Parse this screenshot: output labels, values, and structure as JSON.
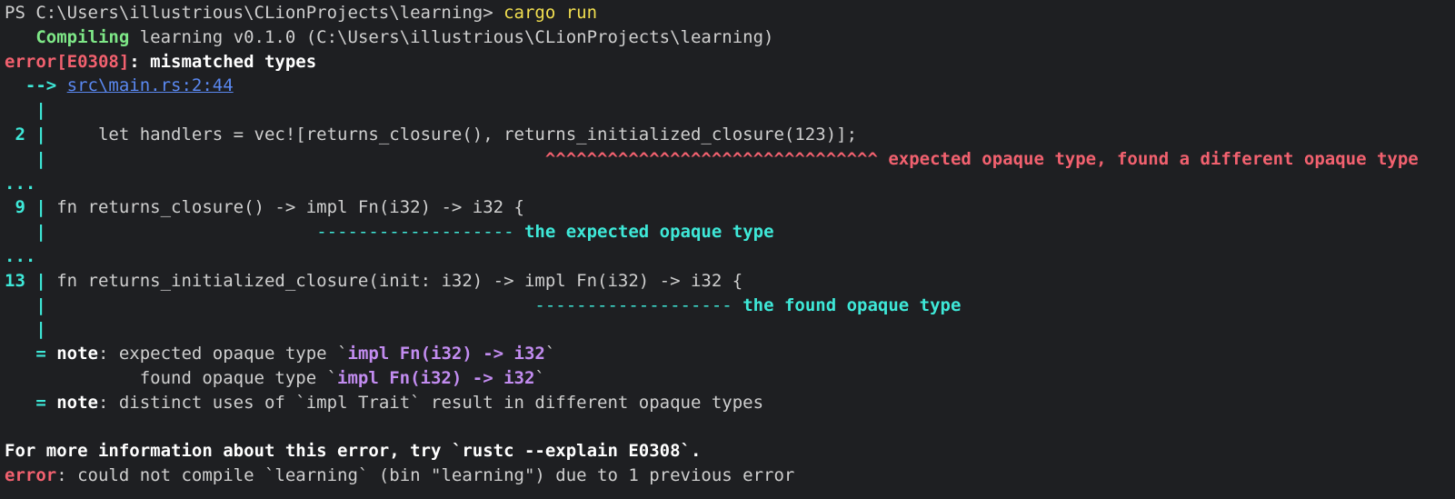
{
  "prompt": {
    "prefix": "PS C:\\Users\\illustrious\\CLionProjects\\learning> ",
    "command": "cargo run"
  },
  "compiling": {
    "label": "Compiling",
    "text": " learning v0.1.0 (C:\\Users\\illustrious\\CLionProjects\\learning)"
  },
  "error_header": {
    "code": "error[E0308]",
    "message": ": mismatched types"
  },
  "location": {
    "arrow": "  --> ",
    "path": "src\\main.rs:2:44"
  },
  "snippet": {
    "gutter_blank": "   |",
    "line2_num": " 2 |",
    "line2_code": "     let handlers = vec![returns_closure(), returns_initialized_closure(123)];",
    "line2_marker_pad": "                                                ",
    "line2_carets": "^^^^^^^^^^^^^^^^^^^^^^^^^^^^^^^^",
    "line2_message": " expected opaque type, found a different opaque type",
    "ellipsis": "...",
    "line9_num": " 9 |",
    "line9_code": " fn returns_closure() -> impl Fn(i32) -> i32 {",
    "line9_pad": "                          ",
    "line9_dashes": "-------------------",
    "line9_message": " the expected opaque type",
    "line13_num": "13 |",
    "line13_code": " fn returns_initialized_closure(init: i32) -> impl Fn(i32) -> i32 {",
    "line13_pad": "                                               ",
    "line13_dashes": "-------------------",
    "line13_message": " the found opaque type"
  },
  "notes": {
    "eq": "   = ",
    "note_label": "note",
    "note1_prefix": ": expected opaque type `",
    "note1_type": "impl Fn(i32) -> i32",
    "tick": "`",
    "note1b_prefix": "             found opaque type `",
    "note1b_type": "impl Fn(i32) -> i32",
    "note2_text": ": distinct uses of `impl Trait` result in different opaque types"
  },
  "footer": {
    "info": "For more information about this error, try `rustc --explain E0308`.",
    "error_label": "error",
    "error_text": ": could not compile `learning` (bin \"learning\") due to 1 previous error"
  }
}
